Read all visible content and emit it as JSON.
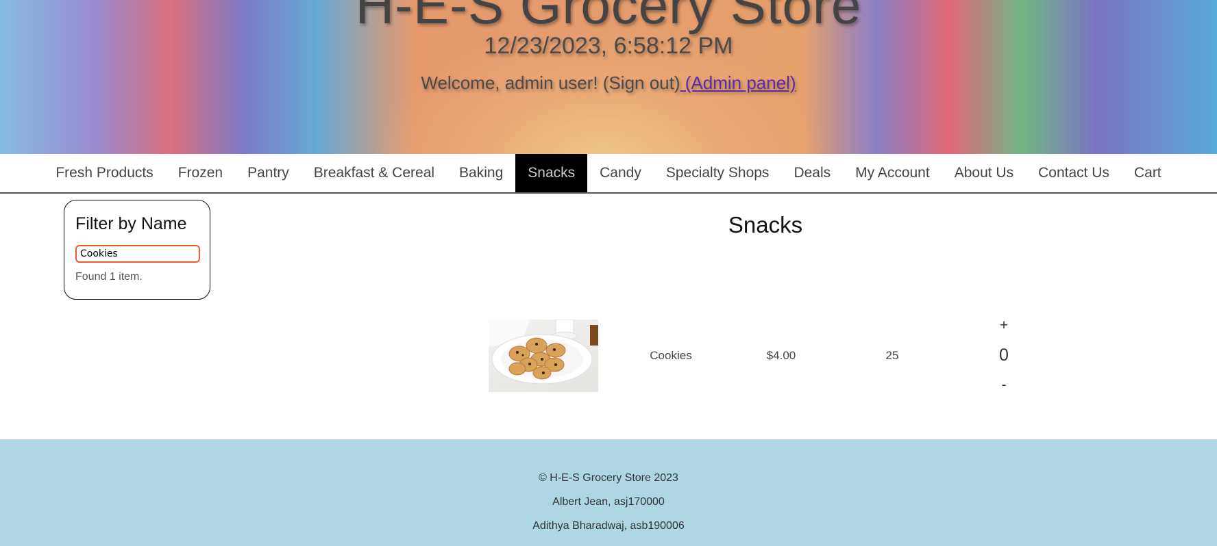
{
  "header": {
    "title": "H-E-S Grocery Store",
    "datetime": "12/23/2023, 6:58:12 PM",
    "welcome": "Welcome, admin user! (Sign out)",
    "admin_link": " (Admin panel)"
  },
  "nav": [
    "Fresh Products",
    "Frozen",
    "Pantry",
    "Breakfast & Cereal",
    "Baking",
    "Snacks",
    "Candy",
    "Specialty Shops",
    "Deals",
    "My Account",
    "About Us",
    "Contact Us",
    "Cart"
  ],
  "nav_active": "Snacks",
  "filter": {
    "heading": "Filter by Name",
    "value": "Cookies",
    "result": "Found 1 item."
  },
  "page_title": "Snacks",
  "products": [
    {
      "name": "Cookies",
      "price": "$4.00",
      "stock": "25",
      "quantity": "0",
      "plus": "+",
      "minus": "-"
    }
  ],
  "footer": [
    "© H-E-S Grocery Store 2023",
    "Albert Jean, asj170000",
    "Adithya Bharadwaj, asb190006"
  ]
}
